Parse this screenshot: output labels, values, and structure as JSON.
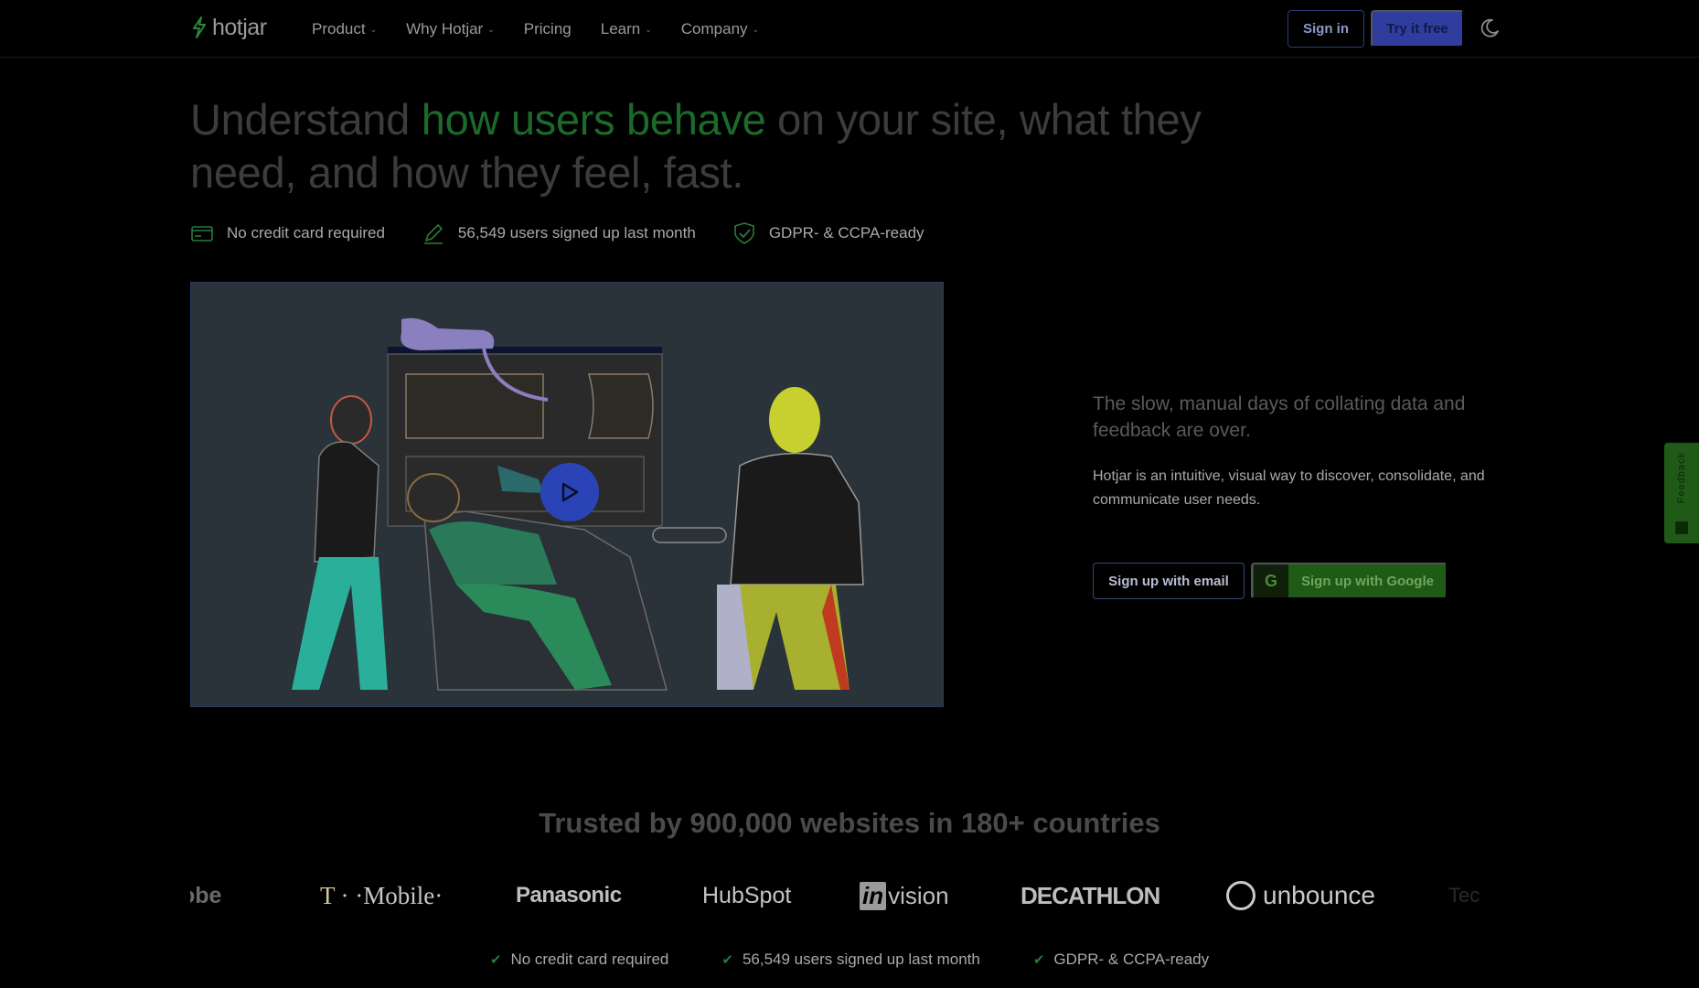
{
  "nav": {
    "logo_text": "hotjar",
    "links": [
      {
        "label": "Product",
        "has_caret": true
      },
      {
        "label": "Why Hotjar",
        "has_caret": true
      },
      {
        "label": "Pricing",
        "has_caret": false
      },
      {
        "label": "Learn",
        "has_caret": true
      },
      {
        "label": "Company",
        "has_caret": true
      }
    ],
    "caret": "⌄",
    "sign_in": "Sign in",
    "try_free": "Try it free",
    "theme_icon": "moon-icon"
  },
  "hero": {
    "headline_pre": "Understand ",
    "headline_accent": "how users behave",
    "headline_post": " on your site, what they need, and how they feel, fast.",
    "badges": [
      {
        "icon": "credit-card-icon",
        "label": "No credit card required"
      },
      {
        "icon": "pencil-icon",
        "label": "56,549 users signed up last month"
      },
      {
        "icon": "shield-check-icon",
        "label": "GDPR- & CCPA-ready"
      }
    ]
  },
  "video": {
    "play_icon": "play-icon"
  },
  "copy": {
    "lead": "The slow, manual days of collating data and feedback are over.",
    "sub": "Hotjar is an intuitive, visual way to discover, consolidate, and communicate user needs.",
    "signup_email": "Sign up with email",
    "signup_google": "Sign up with Google",
    "google_glyph": "G"
  },
  "feedback_tab": {
    "label": "Feedback"
  },
  "trusted": {
    "title": "Trusted by 900,000 websites in 180+ countries",
    "brands": {
      "adobe": "obe",
      "tmobile_mark": "T",
      "tmobile": "· ·Mobile·",
      "panasonic": "Panasonic",
      "hubspot": "HubSpot",
      "invision_mark": "in",
      "invision": "vision",
      "decathlon": "DECATHLON",
      "unbounce": "unbounce",
      "tech": "Tec"
    }
  },
  "bottom_badges": [
    {
      "label": "No credit card required"
    },
    {
      "label": "56,549 users signed up last month"
    },
    {
      "label": "GDPR- & CCPA-ready"
    }
  ],
  "colors": {
    "background": "#000000",
    "accent_green": "#1c6a2b",
    "brand_blue": "#2f3d9e",
    "google_green": "#1f5a17"
  }
}
